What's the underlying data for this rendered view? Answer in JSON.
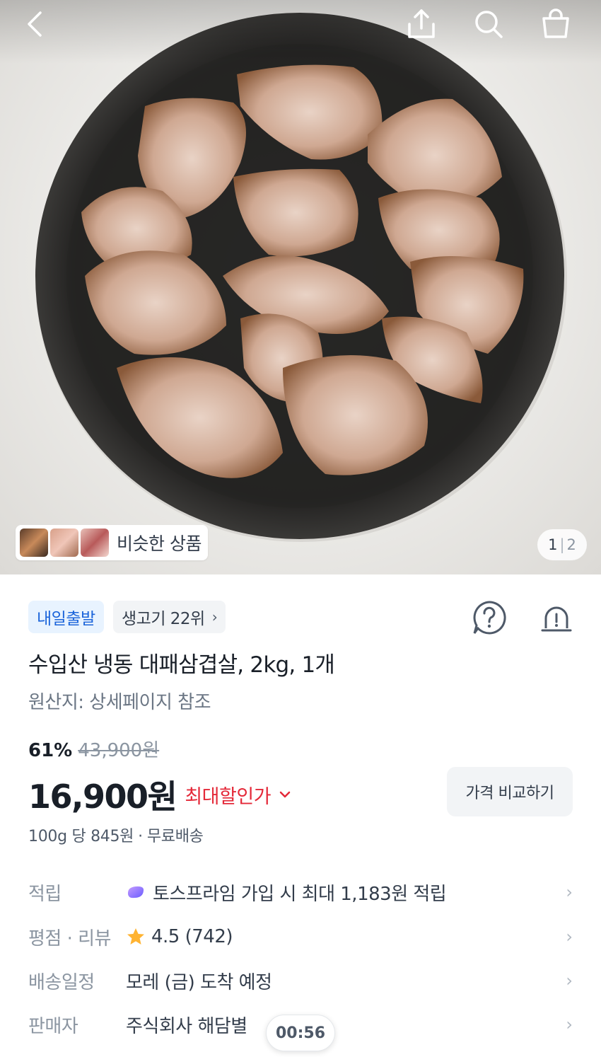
{
  "header": {
    "back_icon": "chevron-left-icon",
    "share_icon": "share-icon",
    "search_icon": "search-icon",
    "cart_icon": "shopping-bag-icon"
  },
  "gallery": {
    "similar_label": "비슷한 상품",
    "current_page": "1",
    "total_pages": "2"
  },
  "badges": {
    "delivery": "내일출발",
    "ranking": "생고기 22위"
  },
  "product": {
    "title": "수입산 냉동 대패삼겹살, 2kg, 1개",
    "origin": "원산지: 상세페이지 참조",
    "discount_rate": "61%",
    "original_price": "43,900원",
    "price": "16,900원",
    "max_discount_label": "최대할인가",
    "compare_button": "가격 비교하기",
    "unit_price": "100g 당 845원",
    "shipping": "무료배송"
  },
  "info_rows": [
    {
      "key": "적립",
      "value": "토스프라임 가입 시 최대 1,183원 적립"
    },
    {
      "key": "평점 · 리뷰",
      "value": "4.5 (742)"
    },
    {
      "key": "배송일정",
      "value": "모레 (금) 도착 예정"
    },
    {
      "key": "판매자",
      "value": "주식회사 해담별"
    }
  ],
  "timer": "00:56",
  "colors": {
    "accent_blue": "#1b64da",
    "discount_red": "#e42939",
    "star": "#ffb331"
  }
}
